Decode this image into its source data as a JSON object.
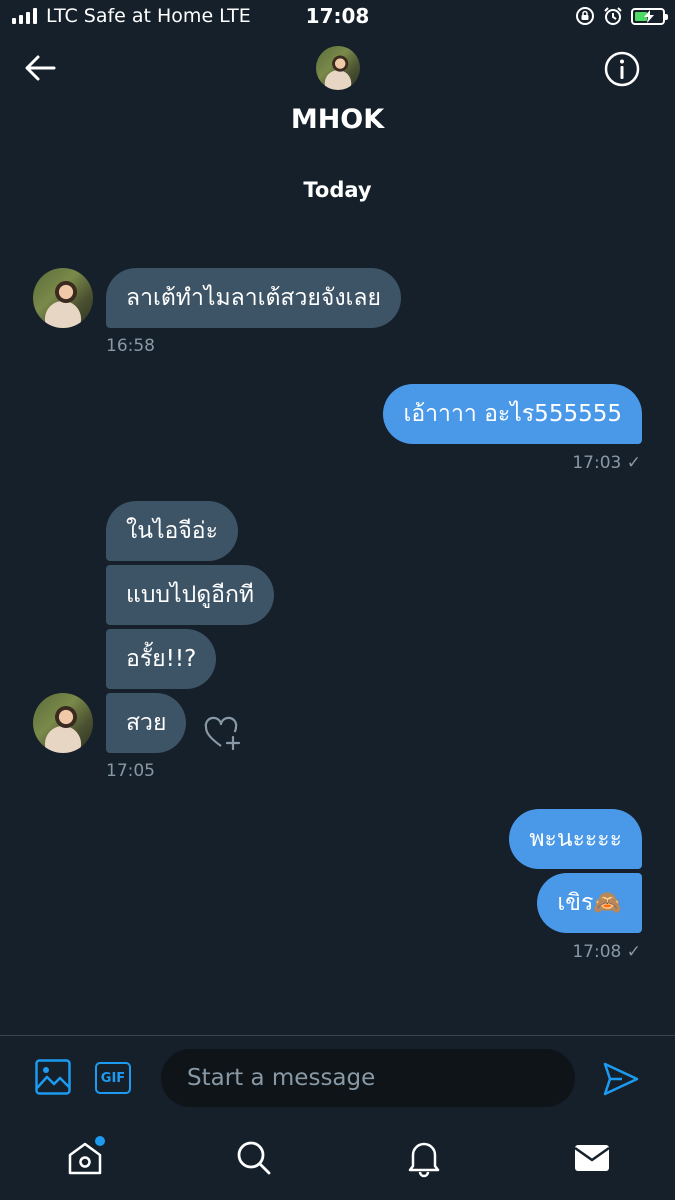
{
  "status_bar": {
    "carrier": "LTC Safe at Home  LTE",
    "time": "17:08"
  },
  "header": {
    "contact_name": "MHOK",
    "back_icon": "arrow-left-icon",
    "info_icon": "info-circle-icon"
  },
  "conversation": {
    "day_label": "Today",
    "messages": [
      {
        "direction": "incoming",
        "text": "ลาเต้ทำไมลาเต้สวยจังเลย"
      },
      {
        "direction": "outgoing",
        "text": "เอ้าาาา อะไร555555"
      },
      {
        "direction": "incoming",
        "text": "ในไอจีอ่ะ"
      },
      {
        "direction": "incoming",
        "text": "แบบไปดูอีกที"
      },
      {
        "direction": "incoming",
        "text": "อรั้ย!!?"
      },
      {
        "direction": "incoming",
        "text": "สวย"
      },
      {
        "direction": "outgoing",
        "text": "พะนะะะะ"
      },
      {
        "direction": "outgoing",
        "text": "เขิร🙈"
      }
    ],
    "timestamps": {
      "t1": "16:58",
      "t2": "17:03 ✓",
      "t3": "17:05",
      "t4": "17:08 ✓"
    }
  },
  "composer": {
    "placeholder": "Start a message",
    "gif_label": "GIF"
  },
  "tab_bar": {
    "items": [
      "home-icon",
      "search-icon",
      "bell-icon",
      "mail-icon"
    ]
  },
  "colors": {
    "background": "#15202b",
    "incoming_bubble": "#3d5466",
    "outgoing_bubble": "#4a99e9",
    "accent": "#1d9bf0",
    "secondary_text": "#8899a6"
  }
}
